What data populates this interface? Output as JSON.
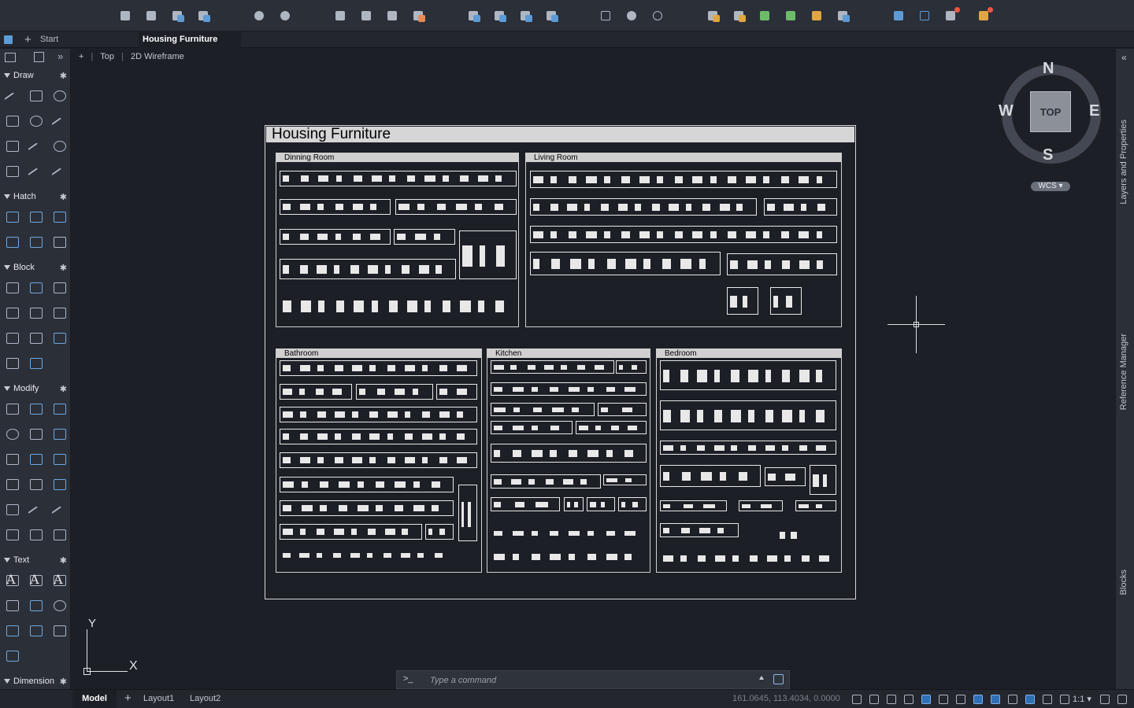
{
  "tabs": {
    "start": "Start",
    "active": "Housing Furniture"
  },
  "viewport": {
    "plus": "+",
    "view": "Top",
    "style": "2D Wireframe"
  },
  "palette": {
    "sections": [
      "Draw",
      "Hatch",
      "Block",
      "Modify",
      "Text",
      "Dimension"
    ]
  },
  "drawing": {
    "title": "Housing Furniture",
    "rooms": {
      "dining": "Dinning Room",
      "living": "Living Room",
      "bathroom": "Bathroom",
      "kitchen": "Kitchen",
      "bedroom": "Bedroom"
    }
  },
  "viewcube": {
    "north": "N",
    "south": "S",
    "east": "E",
    "west": "W",
    "face": "TOP",
    "wcs": "WCS"
  },
  "right_panels": {
    "layers": "Layers and Properties",
    "refs": "Reference Manager",
    "blocks": "Blocks"
  },
  "ucs": {
    "x": "X",
    "y": "Y"
  },
  "command": {
    "prompt": ">_",
    "placeholder": "Type a command"
  },
  "status": {
    "model": "Model",
    "add": "+",
    "layout1": "Layout1",
    "layout2": "Layout2",
    "coords": "161.0645, 113.4034, 0.0000",
    "scale": "1:1"
  }
}
